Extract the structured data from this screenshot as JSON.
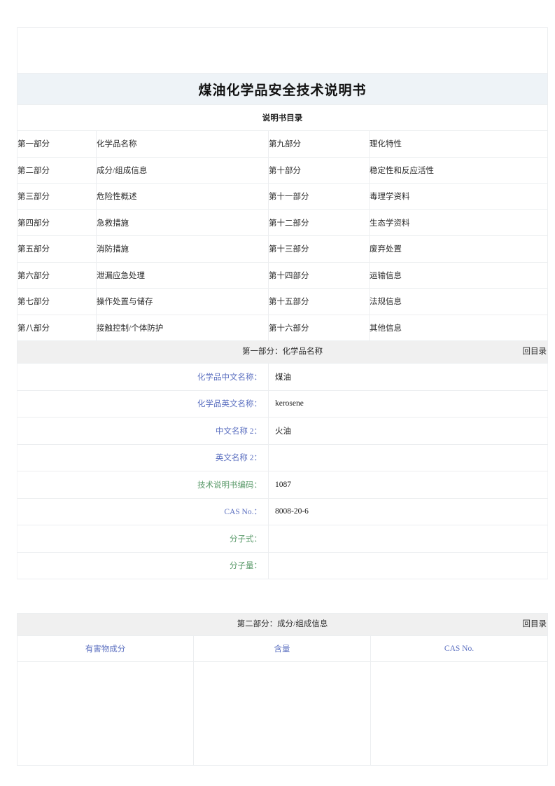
{
  "document": {
    "title": "煤油化学品安全技术说明书",
    "toc_caption": "说明书目录"
  },
  "toc": {
    "rows": [
      {
        "left_no": "第一部分",
        "left_name": "化学品名称",
        "right_no": "第九部分",
        "right_name": "理化特性"
      },
      {
        "left_no": "第二部分",
        "left_name": "成分/组成信息",
        "right_no": "第十部分",
        "right_name": "稳定性和反应活性"
      },
      {
        "left_no": "第三部分",
        "left_name": "危险性概述",
        "right_no": "第十一部分",
        "right_name": "毒理学资料"
      },
      {
        "left_no": "第四部分",
        "left_name": "急救措施",
        "right_no": "第十二部分",
        "right_name": "生态学资料"
      },
      {
        "left_no": "第五部分",
        "left_name": "消防措施",
        "right_no": "第十三部分",
        "right_name": "废弃处置"
      },
      {
        "left_no": "第六部分",
        "left_name": "泄漏应急处理",
        "right_no": "第十四部分",
        "right_name": "运输信息"
      },
      {
        "left_no": "第七部分",
        "left_name": "操作处置与储存",
        "right_no": "第十五部分",
        "right_name": "法规信息"
      },
      {
        "left_no": "第八部分",
        "left_name": "接触控制/个体防护",
        "right_no": "第十六部分",
        "right_name": "其他信息"
      }
    ]
  },
  "section1": {
    "heading": "第一部分：化学品名称",
    "back_to_toc": "回目录",
    "fields": [
      {
        "label": "化学品中文名称：",
        "value": "煤油",
        "color": "blue"
      },
      {
        "label": "化学品英文名称：",
        "value": "kerosene",
        "color": "blue"
      },
      {
        "label": "中文名称 2：",
        "value": "火油",
        "color": "blue"
      },
      {
        "label": "英文名称 2：",
        "value": "",
        "color": "blue"
      },
      {
        "label": "技术说明书编码：",
        "value": "1087",
        "color": "green"
      },
      {
        "label": "CAS No.：",
        "value": "8008-20-6",
        "color": "blue"
      },
      {
        "label": "分子式：",
        "value": "",
        "color": "green"
      },
      {
        "label": "分子量：",
        "value": "",
        "color": "green"
      }
    ]
  },
  "section2": {
    "heading": "第二部分：成分/组成信息",
    "back_to_toc": "回目录",
    "columns": [
      "有害物成分",
      "含量",
      "CAS No."
    ],
    "rows": []
  },
  "colors": {
    "title_band": "#eef3f7",
    "section_band": "#f0f0f0",
    "label_blue": "#5b6fc0",
    "label_green": "#5a9a6a",
    "border": "#eceef0"
  }
}
